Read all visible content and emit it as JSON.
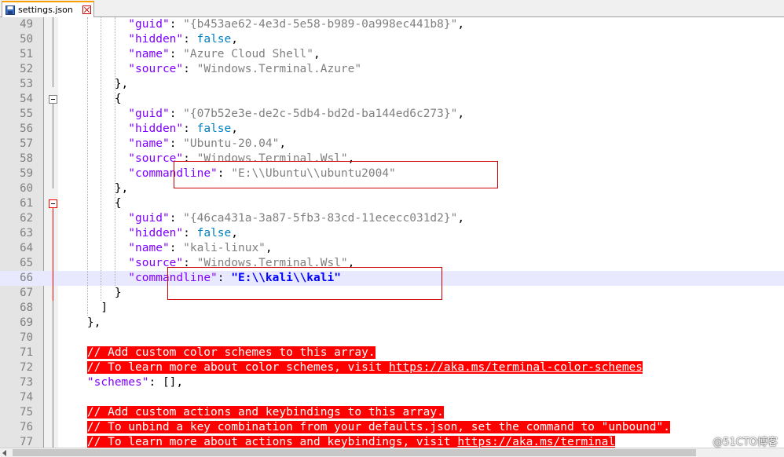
{
  "tab": {
    "label": "settings.json"
  },
  "lines": [
    {
      "n": "49",
      "indent": 10,
      "tokens": [
        [
          "k",
          "\"guid\""
        ],
        [
          "p",
          ": "
        ],
        [
          "s",
          "\"{b453ae62-4e3d-5e58-b989-0a998ec441b8}\""
        ],
        [
          "p",
          ","
        ]
      ]
    },
    {
      "n": "50",
      "indent": 10,
      "tokens": [
        [
          "k",
          "\"hidden\""
        ],
        [
          "p",
          ": "
        ],
        [
          "b",
          "false"
        ],
        [
          "p",
          ","
        ]
      ]
    },
    {
      "n": "51",
      "indent": 10,
      "tokens": [
        [
          "k",
          "\"name\""
        ],
        [
          "p",
          ": "
        ],
        [
          "s",
          "\"Azure Cloud Shell\""
        ],
        [
          "p",
          ","
        ]
      ]
    },
    {
      "n": "52",
      "indent": 10,
      "tokens": [
        [
          "k",
          "\"source\""
        ],
        [
          "p",
          ": "
        ],
        [
          "s",
          "\"Windows.Terminal.Azure\""
        ]
      ]
    },
    {
      "n": "53",
      "indent": 8,
      "tokens": [
        [
          "p",
          "},"
        ]
      ]
    },
    {
      "n": "54",
      "indent": 8,
      "fold": "box",
      "tokens": [
        [
          "p",
          "{"
        ]
      ]
    },
    {
      "n": "55",
      "indent": 10,
      "tokens": [
        [
          "k",
          "\"guid\""
        ],
        [
          "p",
          ": "
        ],
        [
          "s",
          "\"{07b52e3e-de2c-5db4-bd2d-ba144ed6c273}\""
        ],
        [
          "p",
          ","
        ]
      ]
    },
    {
      "n": "56",
      "indent": 10,
      "tokens": [
        [
          "k",
          "\"hidden\""
        ],
        [
          "p",
          ": "
        ],
        [
          "b",
          "false"
        ],
        [
          "p",
          ","
        ]
      ]
    },
    {
      "n": "57",
      "indent": 10,
      "tokens": [
        [
          "k",
          "\"name\""
        ],
        [
          "p",
          ": "
        ],
        [
          "s",
          "\"Ubuntu-20.04\""
        ],
        [
          "p",
          ","
        ]
      ]
    },
    {
      "n": "58",
      "indent": 10,
      "tokens": [
        [
          "k",
          "\"source\""
        ],
        [
          "p",
          ": "
        ],
        [
          "s",
          "\"Windows.Terminal.Wsl\""
        ],
        [
          "p",
          ","
        ]
      ]
    },
    {
      "n": "59",
      "indent": 10,
      "tokens": [
        [
          "k",
          "\"commandline\""
        ],
        [
          "p",
          ": "
        ],
        [
          "s",
          "\"E:\\\\Ubuntu\\\\ubuntu2004\""
        ]
      ]
    },
    {
      "n": "60",
      "indent": 8,
      "tokens": [
        [
          "p",
          "},"
        ]
      ]
    },
    {
      "n": "61",
      "indent": 8,
      "fold": "box-active",
      "tokens": [
        [
          "p",
          "{"
        ]
      ]
    },
    {
      "n": "62",
      "indent": 10,
      "tokens": [
        [
          "k",
          "\"guid\""
        ],
        [
          "p",
          ": "
        ],
        [
          "s",
          "\"{46ca431a-3a87-5fb3-83cd-11ececc031d2}\""
        ],
        [
          "p",
          ","
        ]
      ]
    },
    {
      "n": "63",
      "indent": 10,
      "tokens": [
        [
          "k",
          "\"hidden\""
        ],
        [
          "p",
          ": "
        ],
        [
          "b",
          "false"
        ],
        [
          "p",
          ","
        ]
      ]
    },
    {
      "n": "64",
      "indent": 10,
      "tokens": [
        [
          "k",
          "\"name\""
        ],
        [
          "p",
          ": "
        ],
        [
          "s",
          "\"kali-linux\""
        ],
        [
          "p",
          ","
        ]
      ]
    },
    {
      "n": "65",
      "indent": 10,
      "tokens": [
        [
          "k",
          "\"source\""
        ],
        [
          "p",
          ": "
        ],
        [
          "s",
          "\"Windows.Terminal.Wsl\""
        ],
        [
          "p",
          ","
        ]
      ]
    },
    {
      "n": "66",
      "indent": 10,
      "current": true,
      "tokens": [
        [
          "k",
          "\"commandline\""
        ],
        [
          "p",
          ": "
        ],
        [
          "sb",
          "\"E:\\\\kali\\\\kali\""
        ]
      ]
    },
    {
      "n": "67",
      "indent": 8,
      "tokens": [
        [
          "p",
          "}"
        ]
      ]
    },
    {
      "n": "68",
      "indent": 6,
      "tokens": [
        [
          "p",
          "]"
        ]
      ]
    },
    {
      "n": "69",
      "indent": 4,
      "tokens": [
        [
          "p",
          "},"
        ]
      ]
    },
    {
      "n": "70",
      "indent": 0,
      "tokens": []
    },
    {
      "n": "71",
      "indent": 4,
      "tokens": [
        [
          "cm",
          "// Add custom color schemes to this array."
        ]
      ]
    },
    {
      "n": "72",
      "indent": 4,
      "tokens": [
        [
          "cm",
          "// To learn more about color schemes, visit "
        ],
        [
          "cmu",
          "https://aka.ms/terminal-color-schemes"
        ]
      ]
    },
    {
      "n": "73",
      "indent": 4,
      "tokens": [
        [
          "k",
          "\"schemes\""
        ],
        [
          "p",
          ": [],"
        ]
      ]
    },
    {
      "n": "74",
      "indent": 0,
      "tokens": []
    },
    {
      "n": "75",
      "indent": 4,
      "tokens": [
        [
          "cm",
          "// Add custom actions and keybindings to this array."
        ]
      ]
    },
    {
      "n": "76",
      "indent": 4,
      "tokens": [
        [
          "cm",
          "// To unbind a key combination from your defaults.json, set the command to \"unbound\"."
        ]
      ]
    },
    {
      "n": "77",
      "indent": 4,
      "tokens": [
        [
          "cm",
          "// To learn more about actions and keybindings, visit "
        ],
        [
          "cmu",
          "https://aka.ms/terminal"
        ]
      ]
    }
  ],
  "watermark": "@51CTO博客"
}
